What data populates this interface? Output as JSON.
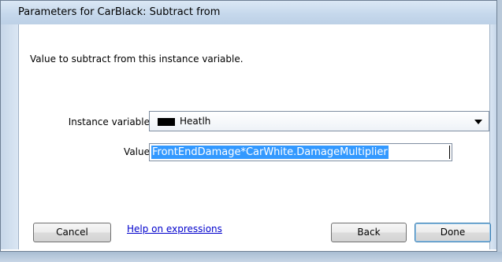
{
  "window": {
    "title": "Parameters for CarBlack: Subtract from"
  },
  "description": "Value to subtract from this instance variable.",
  "instance_variable": {
    "label": "Instance variable",
    "selected": "Heatlh",
    "swatch_color": "#000000"
  },
  "value": {
    "label": "Value",
    "text": "FrontEndDamage*CarWhite.DamageMultiplier"
  },
  "buttons": {
    "cancel": "Cancel",
    "back": "Back",
    "done": "Done"
  },
  "help_link": "Help on expressions",
  "colors": {
    "selection": "#3399ff",
    "link": "#0000cc"
  }
}
